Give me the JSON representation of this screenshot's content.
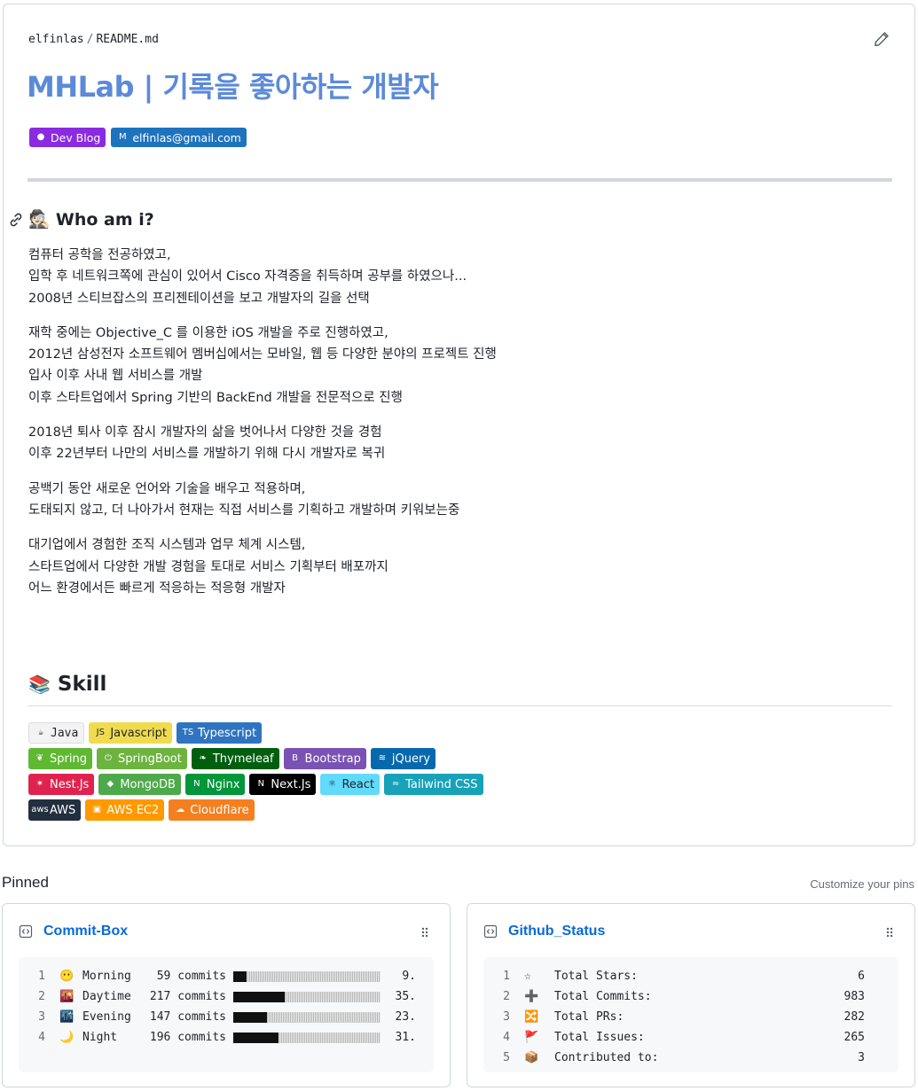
{
  "readme": {
    "owner": "elfinlas",
    "separator": "/",
    "filename": "README.md",
    "title": "MHLab | 기록을 좋아하는 개발자",
    "top_badges": [
      {
        "icon": "github-icon",
        "label": "Dev Blog",
        "color": "#8a2be2"
      },
      {
        "icon": "gmail-icon",
        "label": "elfinlas@gmail.com",
        "color": "#1e73be"
      }
    ],
    "who": {
      "emoji": "🕵🏻",
      "heading": "Who am i?",
      "paragraphs": [
        [
          "컴퓨터 공학을 전공하였고,",
          "입학 후 네트워크쪽에 관심이 있어서 Cisco 자격증을 취득하며 공부를 하였으나...",
          "2008년 스티브잡스의 프리젠테이션을 보고 개발자의 길을 선택"
        ],
        [
          "재학 중에는 Objective_C 를 이용한 iOS 개발을 주로 진행하였고,",
          "2012년 삼성전자 소프트웨어 멤버십에서는 모바일, 웹 등 다양한 분야의 프로젝트 진행",
          "입사 이후 사내 웹 서비스를 개발",
          "이후 스타트업에서 Spring 기반의 BackEnd 개발을 전문적으로 진행"
        ],
        [
          "2018년 퇴사 이후 잠시 개발자의 삶을 벗어나서 다양한 것을 경험",
          "이후 22년부터 나만의 서비스를 개발하기 위해 다시 개발자로 복귀"
        ],
        [
          "공백기 동안 새로운 언어와 기술을 배우고 적용하며,",
          "도태되지 않고, 더 나아가서 현재는 직접 서비스를 기획하고 개발하며 키워보는중"
        ],
        [
          "대기업에서 경험한 조직 시스템과 업무 체계 시스템,",
          "스타트업에서 다양한 개발 경험을 토대로 서비스 기획부터 배포까지",
          "어느 환경에서든 빠르게 적응하는 적응형 개발자"
        ]
      ]
    },
    "skill": {
      "emoji": "📚",
      "heading": "Skill",
      "rows": [
        [
          {
            "label": "Java",
            "icon": "java-icon",
            "color": "#f3f3f3"
          },
          {
            "label": "Javascript",
            "icon": "javascript-icon",
            "color": "#f0db4f"
          },
          {
            "label": "Typescript",
            "icon": "typescript-icon",
            "color": "#2f74c0"
          }
        ],
        [
          {
            "label": "Spring",
            "icon": "spring-icon",
            "color": "#5fb832"
          },
          {
            "label": "SpringBoot",
            "icon": "springboot-icon",
            "color": "#6db33f"
          },
          {
            "label": "Thymeleaf",
            "icon": "thymeleaf-icon",
            "color": "#005f0f"
          },
          {
            "label": "Bootstrap",
            "icon": "bootstrap-icon",
            "color": "#7952b3"
          },
          {
            "label": "jQuery",
            "icon": "jquery-icon",
            "color": "#0769ad"
          }
        ],
        [
          {
            "label": "Nest.Js",
            "icon": "nestjs-icon",
            "color": "#e0234e"
          },
          {
            "label": "MongoDB",
            "icon": "mongodb-icon",
            "color": "#4ea94b"
          },
          {
            "label": "Nginx",
            "icon": "nginx-icon",
            "color": "#009639"
          },
          {
            "label": "Next.Js",
            "icon": "nextjs-icon",
            "color": "#000000"
          },
          {
            "label": "React",
            "icon": "react-icon",
            "color": "#61dafb"
          },
          {
            "label": "Tailwind CSS",
            "icon": "tailwind-icon",
            "color": "#17a2b8"
          }
        ],
        [
          {
            "label": "AWS",
            "icon": "aws-icon",
            "color": "#232f3e"
          },
          {
            "label": "AWS EC2",
            "icon": "aws-ec2-icon",
            "color": "#ff9900"
          },
          {
            "label": "Cloudflare",
            "icon": "cloudflare-icon",
            "color": "#f38020"
          }
        ]
      ]
    }
  },
  "pinned": {
    "title": "Pinned",
    "customize_label": "Customize your pins",
    "cards": [
      {
        "name": "Commit-Box",
        "lines": [
          {
            "n": "1",
            "emoji": "😶",
            "label": "Morning",
            "count": "59 commits",
            "fraction": 0.09,
            "pct": "9."
          },
          {
            "n": "2",
            "emoji": "🌇",
            "label": "Daytime",
            "count": "217 commits",
            "fraction": 0.35,
            "pct": "35."
          },
          {
            "n": "3",
            "emoji": "🌃",
            "label": "Evening",
            "count": "147 commits",
            "fraction": 0.23,
            "pct": "23."
          },
          {
            "n": "4",
            "emoji": "🌙",
            "label": "Night",
            "count": "196 commits",
            "fraction": 0.31,
            "pct": "31."
          }
        ]
      },
      {
        "name": "Github_Status",
        "lines": [
          {
            "n": "1",
            "emoji": "☆",
            "label": "Total Stars:",
            "value": "6"
          },
          {
            "n": "2",
            "emoji": "➕",
            "label": "Total Commits:",
            "value": "983"
          },
          {
            "n": "3",
            "emoji": "🔀",
            "label": "Total PRs:",
            "value": "282"
          },
          {
            "n": "4",
            "emoji": "🚩",
            "label": "Total Issues:",
            "value": "265"
          },
          {
            "n": "5",
            "emoji": "📦",
            "label": "Contributed to:",
            "value": "3"
          }
        ]
      }
    ]
  }
}
